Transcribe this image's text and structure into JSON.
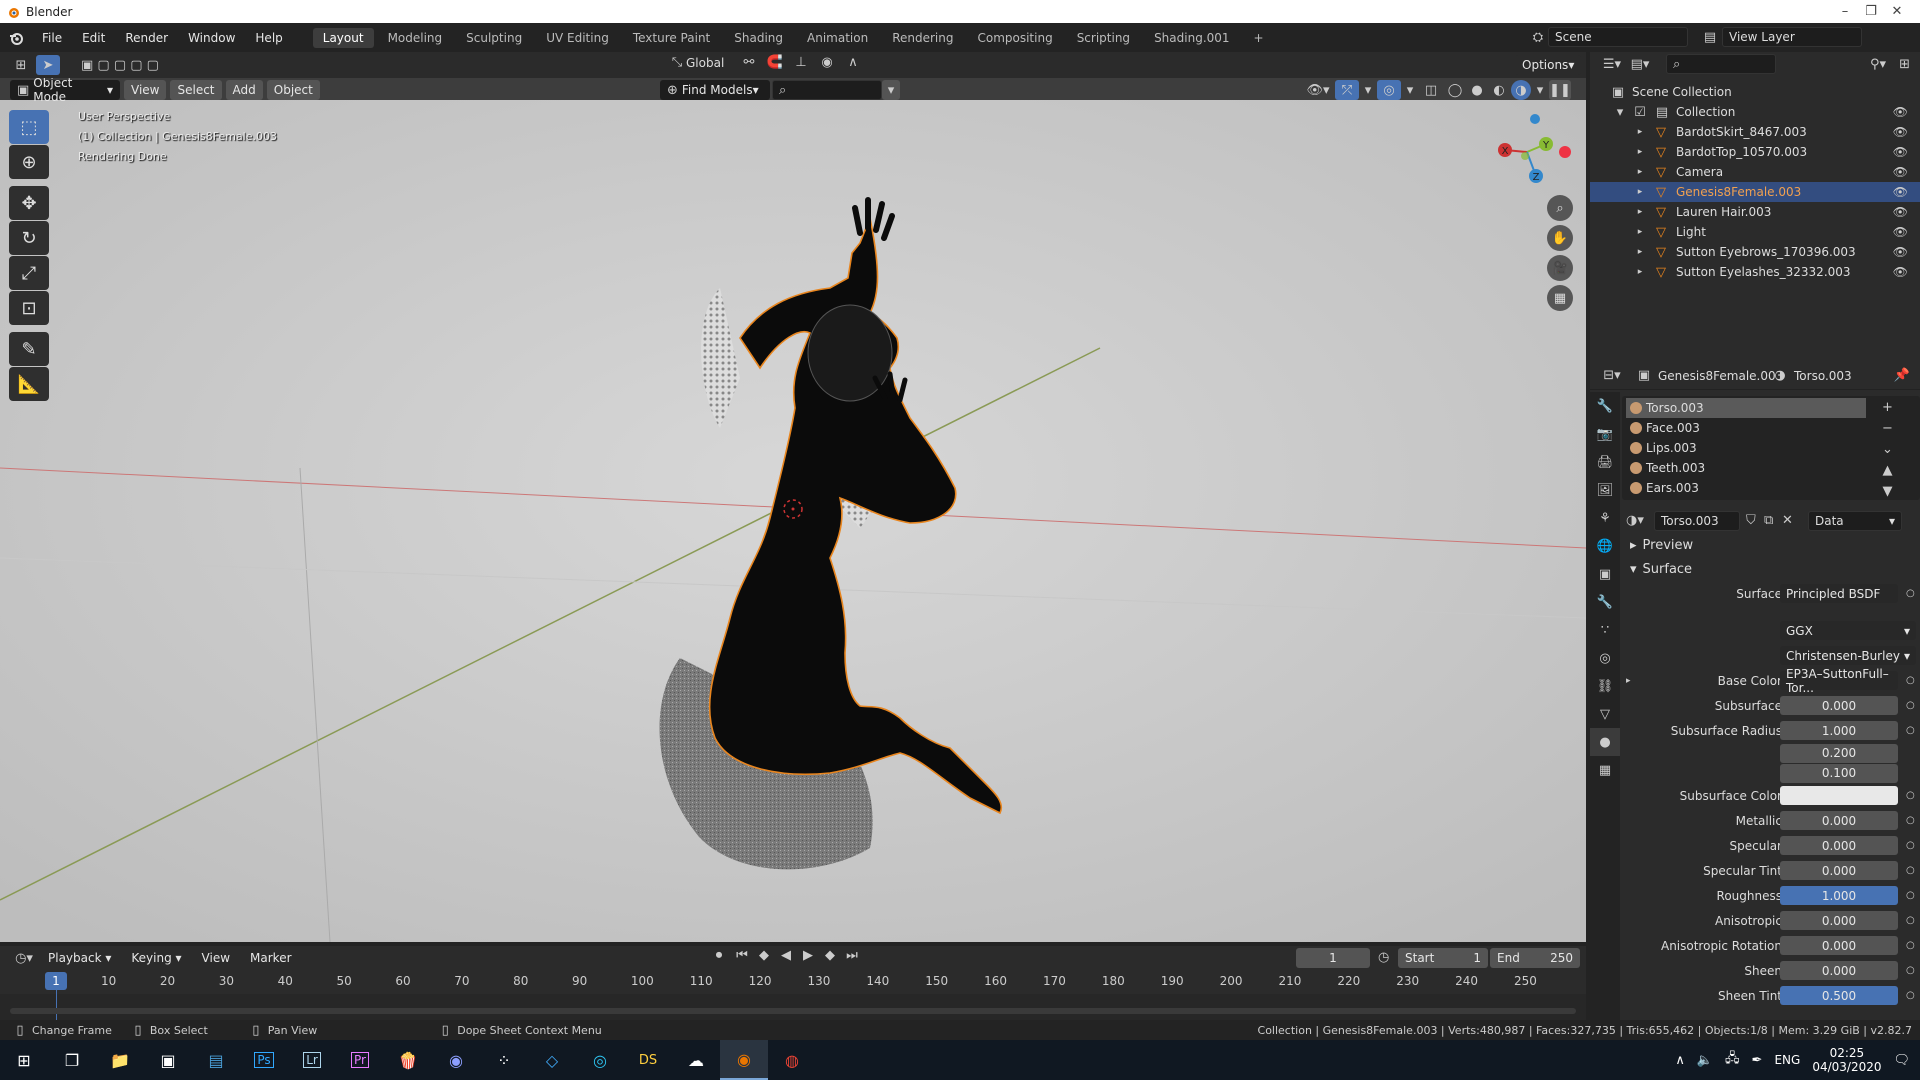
{
  "window": {
    "title": "Blender",
    "minimize": "–",
    "maximize": "❐",
    "close": "✕"
  },
  "menu": [
    "File",
    "Edit",
    "Render",
    "Window",
    "Help"
  ],
  "workspaces": [
    "Layout",
    "Modeling",
    "Sculpting",
    "UV Editing",
    "Texture Paint",
    "Shading",
    "Animation",
    "Rendering",
    "Compositing",
    "Scripting",
    "Shading.001"
  ],
  "workspace_add": "+",
  "scene": {
    "label": "Scene",
    "view_layer": "View Layer"
  },
  "viewport_header": {
    "transform_orientation": "Global",
    "options": "Options",
    "mode": "Object Mode",
    "view": "View",
    "select": "Select",
    "add": "Add",
    "object": "Object",
    "find_models": "Find Models"
  },
  "viewport_overlay": {
    "line1": "User Perspective",
    "line2": "(1) Collection | Genesis8Female.003",
    "line3": "Rendering Done"
  },
  "gizmo": {
    "x": "X",
    "y": "Y",
    "z": "Z"
  },
  "outliner": {
    "root": "Scene Collection",
    "collection": "Collection",
    "items": [
      {
        "name": "BardotSkirt_8467.003",
        "selected": false
      },
      {
        "name": "BardotTop_10570.003",
        "selected": false
      },
      {
        "name": "Camera",
        "selected": false
      },
      {
        "name": "Genesis8Female.003",
        "selected": true
      },
      {
        "name": "Lauren Hair.003",
        "selected": false
      },
      {
        "name": "Light",
        "selected": false
      },
      {
        "name": "Sutton Eyebrows_170396.003",
        "selected": false
      },
      {
        "name": "Sutton Eyelashes_32332.003",
        "selected": false
      }
    ]
  },
  "properties": {
    "object_name": "Genesis8Female.003",
    "material_name": "Torso.003",
    "slots": [
      "Torso.003",
      "Face.003",
      "Lips.003",
      "Teeth.003",
      "Ears.003"
    ],
    "material_field": "Torso.003",
    "data_link": "Data",
    "preview": "Preview",
    "surface_section": "Surface",
    "surface_label": "Surface",
    "surface_value": "Principled BSDF",
    "distribution": "GGX",
    "subsurface_method": "Christensen-Burley",
    "rows": [
      {
        "label": "Base Color",
        "value": "EP3A–SuttonFull–Tor...",
        "kind": "dropdown"
      },
      {
        "label": "Subsurface",
        "value": "0.000",
        "kind": "num"
      },
      {
        "label": "Subsurface Radius",
        "value": "1.000",
        "kind": "num"
      },
      {
        "label": "",
        "value": "0.200",
        "kind": "num"
      },
      {
        "label": "",
        "value": "0.100",
        "kind": "num"
      },
      {
        "label": "Subsurface Color",
        "value": "",
        "kind": "white"
      },
      {
        "label": "Metallic",
        "value": "0.000",
        "kind": "num"
      },
      {
        "label": "Specular",
        "value": "0.000",
        "kind": "num"
      },
      {
        "label": "Specular Tint",
        "value": "0.000",
        "kind": "num"
      },
      {
        "label": "Roughness",
        "value": "1.000",
        "kind": "blue"
      },
      {
        "label": "Anisotropic",
        "value": "0.000",
        "kind": "num"
      },
      {
        "label": "Anisotropic Rotation",
        "value": "0.000",
        "kind": "num"
      },
      {
        "label": "Sheen",
        "value": "0.000",
        "kind": "num"
      },
      {
        "label": "Sheen Tint",
        "value": "0.500",
        "kind": "blue"
      }
    ]
  },
  "timeline": {
    "playback": "Playback",
    "keying": "Keying",
    "view": "View",
    "marker": "Marker",
    "current_frame": "1",
    "start_label": "Start",
    "start": "1",
    "end_label": "End",
    "end": "250",
    "ticks": [
      "1",
      "10",
      "20",
      "30",
      "40",
      "50",
      "60",
      "70",
      "80",
      "90",
      "100",
      "110",
      "120",
      "130",
      "140",
      "150",
      "160",
      "170",
      "180",
      "190",
      "200",
      "210",
      "220",
      "230",
      "240",
      "250"
    ]
  },
  "statusbar": {
    "change_frame": "Change Frame",
    "box_select": "Box Select",
    "pan_view": "Pan View",
    "context_menu": "Dope Sheet Context Menu",
    "stats": "Collection | Genesis8Female.003 | Verts:480,987 | Faces:327,735 | Tris:655,462 | Objects:1/8 | Mem: 3.29 GiB | v2.82.7"
  },
  "taskbar": {
    "lang": "ENG",
    "time": "02:25",
    "date": "04/03/2020",
    "apps": [
      "Ps",
      "Lr",
      "Pr",
      "DS"
    ]
  },
  "colors": {
    "accent": "#4772b3",
    "selection_outline": "#e8851e",
    "selected_row": "#334d80"
  }
}
